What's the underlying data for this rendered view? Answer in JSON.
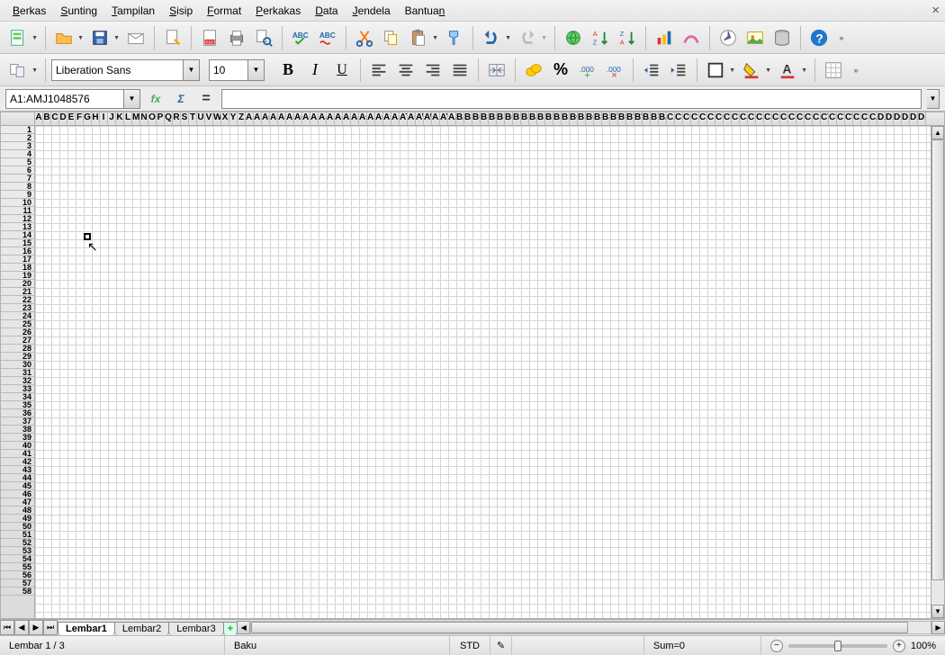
{
  "menu": {
    "berkas": "Berkas",
    "sunting": "Sunting",
    "tampilan": "Tampilan",
    "sisip": "Sisip",
    "format": "Format",
    "perkakas": "Perkakas",
    "data": "Data",
    "jendela": "Jendela",
    "bantuan": "Bantuan"
  },
  "toolbar1": {
    "font_name": "Liberation Sans",
    "font_size": "10"
  },
  "formulabar": {
    "namebox": "A1:AMJ1048576",
    "fx": "fx",
    "sigma": "Σ",
    "eq": "="
  },
  "col_letters": "ABCDEFGHIJKLMNOPQRSTUVWXYZ",
  "rows_visible": 58,
  "cursor_glyph": "↖",
  "tabs": {
    "nav": [
      "⏮",
      "◀",
      "▶",
      "⏭"
    ],
    "t1": "Lembar1",
    "t2": "Lembar2",
    "t3": "Lembar3",
    "add": "+"
  },
  "status": {
    "sheet": "Lembar 1 / 3",
    "style": "Baku",
    "mode": "STD",
    "sum": "Sum=0",
    "zoom_minus": "−",
    "zoom_plus": "+",
    "zoom_pct": "100%"
  }
}
